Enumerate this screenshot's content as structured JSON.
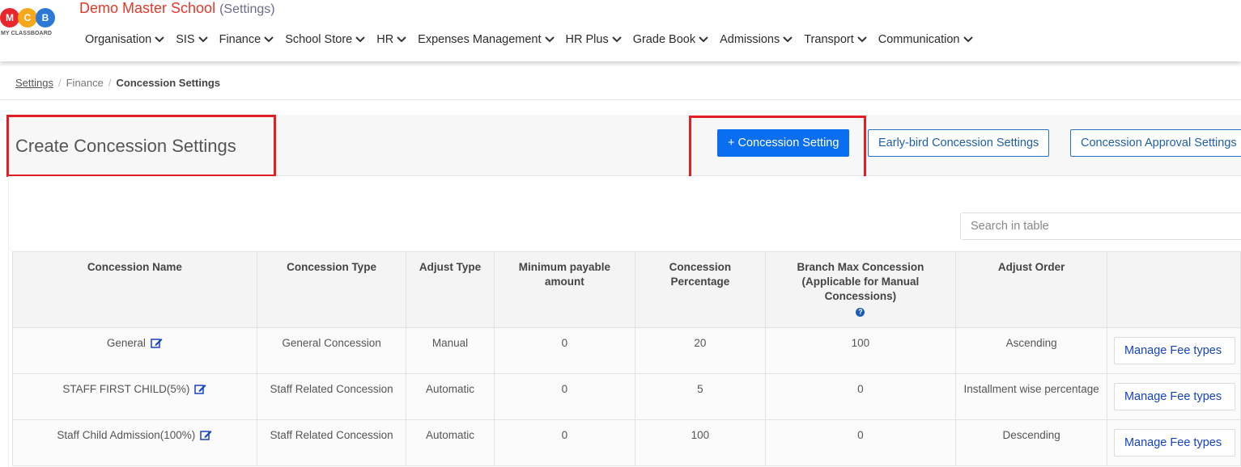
{
  "brand": {
    "logo_letters": [
      "M",
      "C",
      "B"
    ],
    "logo_text": "MY CLASSBOARD",
    "school_name": "Demo Master School",
    "section": "(Settings)"
  },
  "nav": [
    {
      "label": "Organisation"
    },
    {
      "label": "SIS"
    },
    {
      "label": "Finance"
    },
    {
      "label": "School Store"
    },
    {
      "label": "HR"
    },
    {
      "label": "Expenses Management"
    },
    {
      "label": "HR Plus"
    },
    {
      "label": "Grade Book"
    },
    {
      "label": "Admissions"
    },
    {
      "label": "Transport"
    },
    {
      "label": "Communication"
    }
  ],
  "breadcrumb": {
    "items": [
      "Settings",
      "Finance"
    ],
    "current": "Concession Settings"
  },
  "page": {
    "title": "Create Concession Settings",
    "add_button": "+ Concession Setting",
    "earlybird_button": "Early-bird Concession Settings",
    "approval_button": "Concession Approval Settings"
  },
  "search": {
    "placeholder": "Search in table",
    "value": ""
  },
  "table": {
    "headers": [
      "Concession Name",
      "Concession Type",
      "Adjust Type",
      "Minimum payable amount",
      "Concession Percentage",
      "Branch Max Concession (Applicable for Manual Concessions)",
      "Adjust Order",
      ""
    ],
    "rows": [
      {
        "name": "General",
        "type": "General Concession",
        "adjust_type": "Manual",
        "min_payable": "0",
        "percentage": "20",
        "branch_max": "100",
        "adjust_order": "Ascending",
        "action": "Manage Fee types"
      },
      {
        "name": "STAFF FIRST CHILD(5%)",
        "type": "Staff Related Concession",
        "adjust_type": "Automatic",
        "min_payable": "0",
        "percentage": "5",
        "branch_max": "0",
        "adjust_order": "Installment wise percentage",
        "action": "Manage Fee types"
      },
      {
        "name": "Staff Child Admission(100%)",
        "type": "Staff Related Concession",
        "adjust_type": "Automatic",
        "min_payable": "0",
        "percentage": "100",
        "branch_max": "0",
        "adjust_order": "Descending",
        "action": "Manage Fee types"
      }
    ]
  },
  "colors": {
    "brand_red": "#e4392b",
    "primary_button": "#0a6ef0",
    "highlight": "#e31e24",
    "link_blue": "#1642c4"
  }
}
